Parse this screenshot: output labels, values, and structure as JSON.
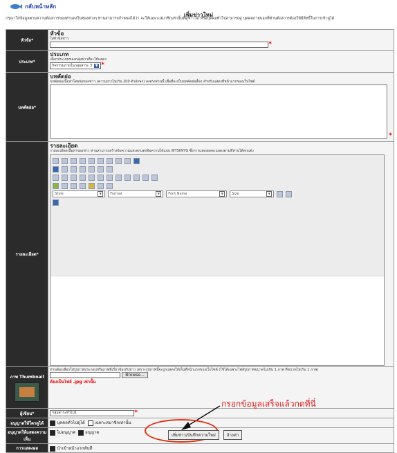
{
  "header": {
    "back_link": "กลับหน้าหลัก"
  },
  "page_title": "เพิ่มข่าวใหม่",
  "intro_text": "กรุณาใส่ข้อมูลตามความต้องการของท่านลงในช่องต่างๆ ท่านสามารถกำหนดได้ว่า จะให้เฉพาะสมาชิกเท่านั้นที่ดูข่าวได้ หรือบุคคลทั่วไปสามารถดู บุคคลภายนอกที่ท่านต้องการต้องให้มีสิทธิ์ในการเข้าดูได้",
  "fields": {
    "subject": {
      "label": "หัวข้อ*",
      "title": "หัวข้อ",
      "desc": "ใส่หัวข้อข่าว"
    },
    "category": {
      "label": "ประเภท*",
      "title": "ประเภท",
      "desc": "เลือกประเภทของกลุ่มข่าวที่จะให้แสดง",
      "selected": "กิจกรรมภายในกลุ่มสาระ 3"
    },
    "summary": {
      "label": "บทคัดย่อ*",
      "title": "บทคัดย่อ",
      "desc": "บทคัดย่อเนื้อหาโดยย่อของข่าว (ความยาวไม่เกิน 200 ตัวอักษร) ลงตรงส่วนนี้ เพื่อที่จะเป็นบทคัดย่อสั้นๆ สำหรับแสดงที่หน้าแรกของเว็บไซต์"
    },
    "detail": {
      "label": "รายละเอียด*",
      "title": "รายละเอียด",
      "desc": "รายละเอียดเนื้อหาของข่าว ท่านสามารถสร้างข้อความและตกแต่งข้อความได้แบบ WYSIWYG ซึ่งการแสดงผลจะแสดงตามที่ท่านได้ตกแต่ง",
      "editor": {
        "style_label": "Style",
        "format_label": "Format",
        "font_label": "Font Name",
        "size_label": "Size"
      }
    },
    "thumbnail": {
      "label": "ภาพ Thumbnail",
      "desc": "ท่านต้องเลือกใส่รูปภาพประกอบหรือภาพที่เกี่ยวข้องกับข่าว เพราะรูปภาพนี้จะถูกแสดงให้เห็นที่หน้าแรกของเว็บไซต์ (ใช้ได้เฉพาะไฟล์รูปภาพขนาดไม่เกิน 1 ภาพ ที่ขนาดไม่เกิน 1 ภาพ)",
      "browse_label": "Browse...",
      "warning": "ต้องเป็นไฟล์ .jpg เท่านั้น"
    },
    "author": {
      "label": "ผู้เขียน*",
      "value": "กลุ่มสาระทั่วไป1"
    },
    "permission": {
      "label": "อนุญาตให้ใครดูได้",
      "opt_public": "บุคคลทั่วไปดูได้",
      "opt_member": "เฉพาะสมาชิกเท่านั้น"
    },
    "comments": {
      "label": "อนุญาตให้แสดงความเห็น",
      "opt_yes": "ไม่อนุญาต",
      "opt_no": "อนุญาต"
    },
    "status": {
      "label": "การแสดงผล",
      "opt": "นำเข้าหน้าแรกทันที"
    }
  },
  "buttons": {
    "submit": "เพิ่มข่าว/บันทึกความใหม่",
    "reset": "ล้างค่า"
  },
  "annotation": "กรอกข้อมูลเสร็จแล้วกดที่นี่",
  "colors": {
    "label_bg": "#2b2b2b",
    "required": "#e00000",
    "annotation": "#e02020"
  }
}
